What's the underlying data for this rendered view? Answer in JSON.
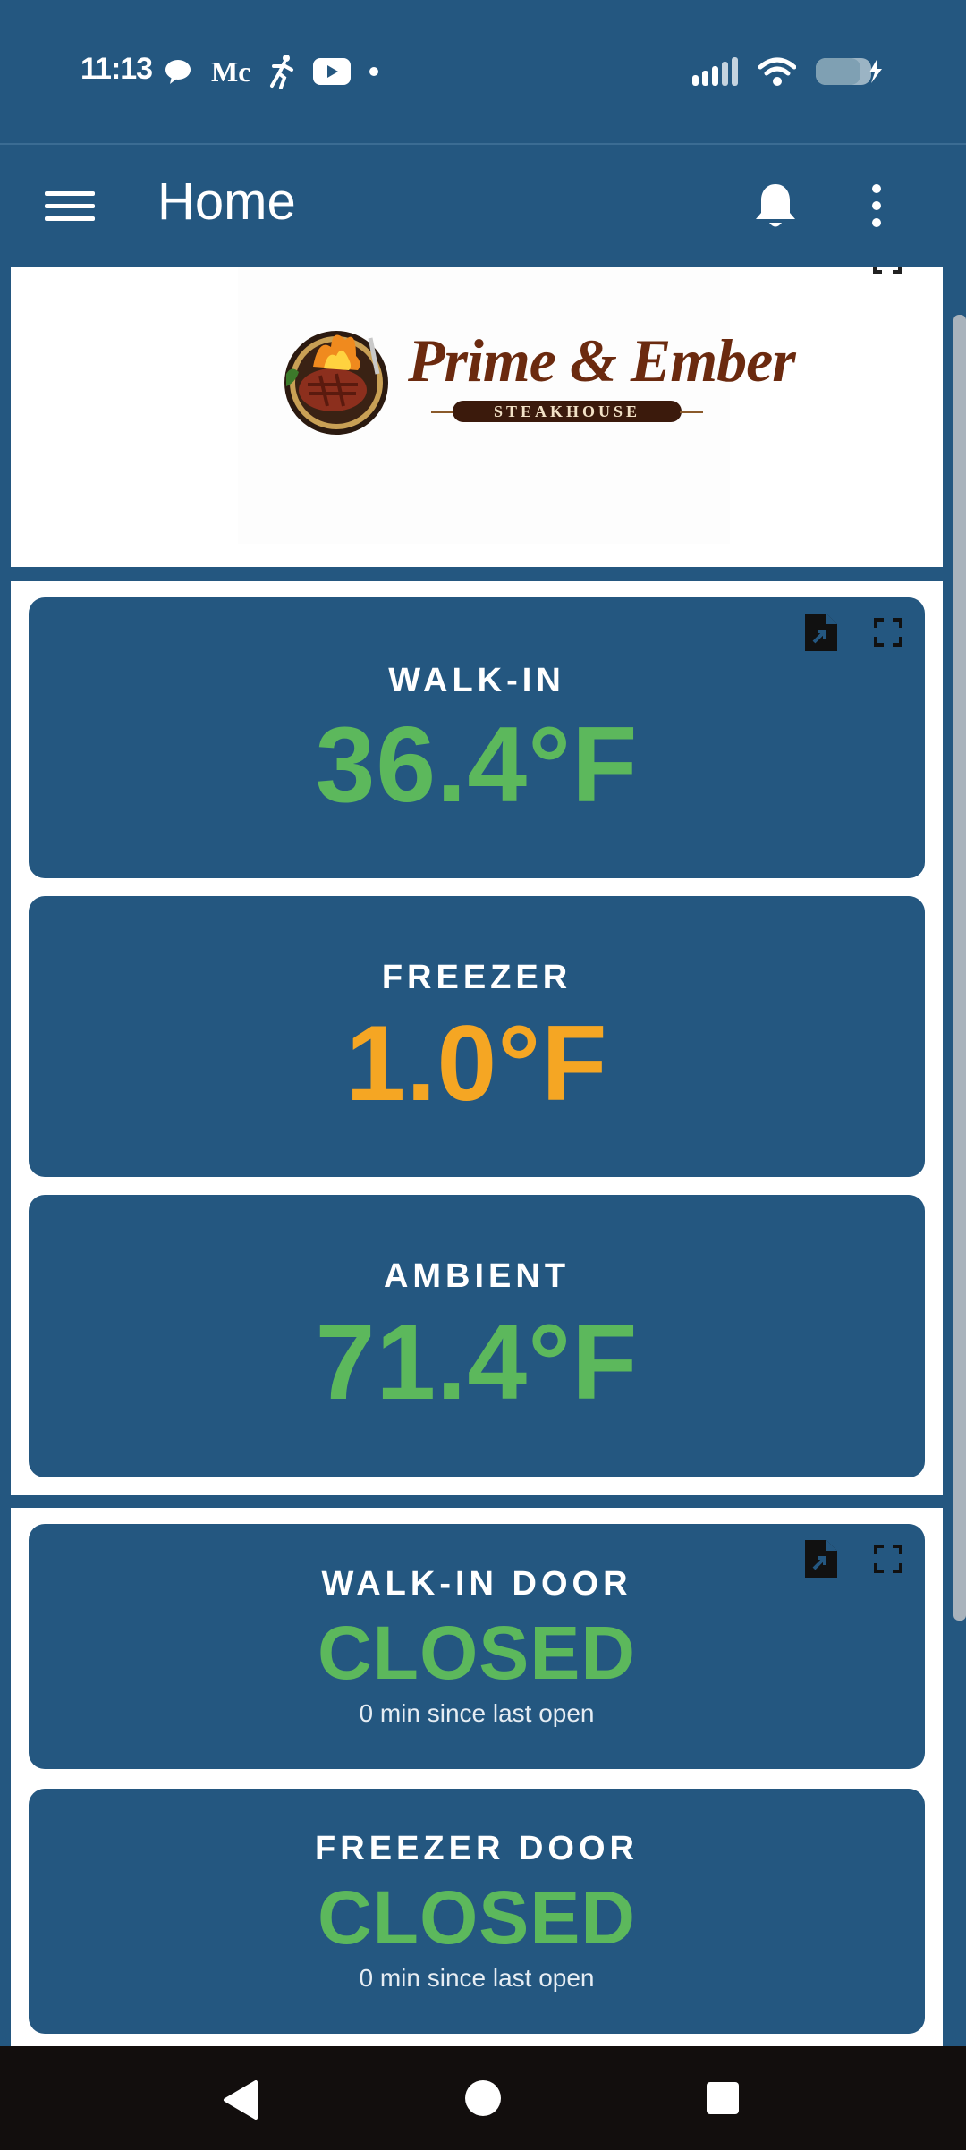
{
  "status_bar": {
    "time": "11:13",
    "notification_icons": [
      "chat-bubble-icon",
      "mc-app-icon",
      "running-figure-icon",
      "youtube-icon",
      "dot-icon"
    ],
    "mc_label": "Mc",
    "battery_level": 0.8,
    "charging": true
  },
  "app_bar": {
    "title": "Home"
  },
  "logo": {
    "brand": "Prime & Ember",
    "tagline": "STEAKHOUSE"
  },
  "temperature_tiles": [
    {
      "label": "WALK-IN",
      "value": "36.4°F",
      "color": "#5cb85c"
    },
    {
      "label": "FREEZER",
      "value": "1.0°F",
      "color": "#f5a623"
    },
    {
      "label": "AMBIENT",
      "value": "71.4°F",
      "color": "#5cb85c"
    }
  ],
  "door_tiles": [
    {
      "label": "WALK-IN DOOR",
      "value": "CLOSED",
      "sub": "0 min since last open",
      "color": "#5cb85c"
    },
    {
      "label": "FREEZER DOOR",
      "value": "CLOSED",
      "sub": "0 min since last open",
      "color": "#5cb85c"
    }
  ],
  "colors": {
    "primary": "#245780",
    "ok": "#5cb85c",
    "warn": "#f5a623"
  }
}
